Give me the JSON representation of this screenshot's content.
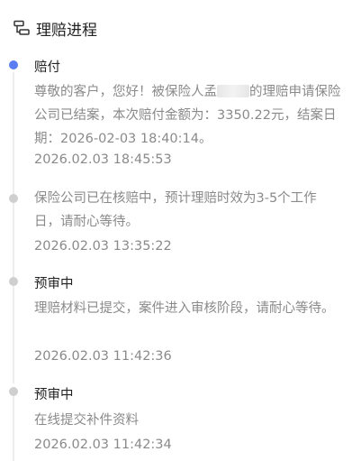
{
  "header": {
    "title": "理赔进程",
    "icon": "timeline-list-icon"
  },
  "accent_color": "#5b7cf3",
  "inactive_dot_color": "#cfcfcf",
  "events": [
    {
      "title": "赔付",
      "desc_before_mask": "尊敬的客户，您好！被保险人孟",
      "desc_after_mask": "的理赔申请保险公司已结案，本次赔付金额为：3350.22元，结案日期：2026-02-03 18:40:14。",
      "time": "2026.02.03 18:45:53",
      "active": true
    },
    {
      "title": "",
      "desc": "保险公司已在核赔中，预计理赔时效为3-5个工作日，请耐心等待。",
      "time": "2026.02.03 13:35:22",
      "active": false
    },
    {
      "title": "预审中",
      "desc": "理赔材料已提交，案件进入审核阶段，请耐心等待。",
      "time": "2026.02.03 11:42:36",
      "active": false
    },
    {
      "title": "预审中",
      "desc": "在线提交补件资料",
      "time": "2026.02.03 11:42:34",
      "active": false
    }
  ]
}
